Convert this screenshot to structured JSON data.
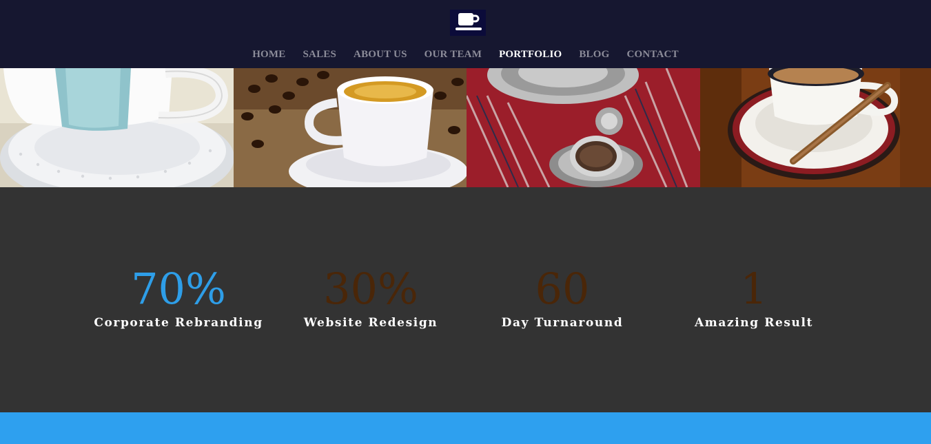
{
  "logo": {
    "icon": "coffee-cup-icon"
  },
  "nav": {
    "items": [
      {
        "label": "HOME"
      },
      {
        "label": "SALES"
      },
      {
        "label": "ABOUT US"
      },
      {
        "label": "OUR TEAM"
      },
      {
        "label": "PORTFOLIO"
      },
      {
        "label": "BLOG"
      },
      {
        "label": "CONTACT"
      }
    ],
    "active": "PORTFOLIO"
  },
  "gallery": {
    "images": [
      {
        "name": "teacup-on-saucer-photo"
      },
      {
        "name": "espresso-with-beans-photo"
      },
      {
        "name": "turkish-coffee-photo"
      },
      {
        "name": "coffee-with-cinnamon-photo"
      }
    ]
  },
  "stats": [
    {
      "value": "70%",
      "label": "Corporate Rebranding",
      "color": "#2e9ee8"
    },
    {
      "value": "30%",
      "label": "Website Redesign",
      "color": "#4a2608"
    },
    {
      "value": "60",
      "label": "Day Turnaround",
      "color": "#4a2608"
    },
    {
      "value": "1",
      "label": "Amazing Result",
      "color": "#4a2608"
    }
  ],
  "colors": {
    "header_bg": "#161730",
    "stats_bg": "#333333",
    "accent": "#2ea0ef"
  }
}
